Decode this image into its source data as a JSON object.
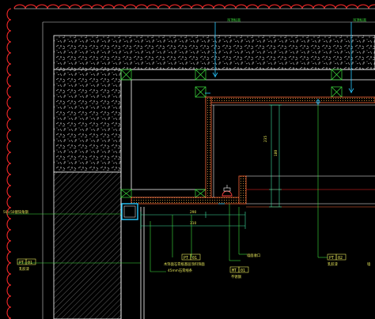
{
  "colors": {
    "background": "#000000",
    "cloud_line": "#ff2a2a",
    "wall": "#ffffff",
    "finish": "#ff6a3a",
    "leader": "#2ee02e",
    "dimension": "#3ee0a0",
    "axis": "#28c8ff",
    "label": "#e8e85a"
  },
  "labels": {
    "top_note_left": "吊顶标高",
    "top_note_right": "吊顶标高",
    "left_side_note": "50×50镀锌角钢",
    "dim_vertical_1": "235",
    "dim_vertical_2": "180",
    "dim_horizontal_1": "290",
    "dim_horizontal_2": "310"
  },
  "tags": [
    {
      "id": "tag-left",
      "code": "PT",
      "num": "01",
      "note": "乳胶漆"
    },
    {
      "id": "tag-mid",
      "code": "PT",
      "num": "01",
      "note": "木饰面",
      "note2": "石膏板基层涂料饰面",
      "note3": "45mm石膏线条"
    },
    {
      "id": "tag-mt",
      "code": "MT",
      "num": "01",
      "note": "不锈钢"
    },
    {
      "id": "tag-right",
      "code": "PT",
      "num": "02",
      "note": "乳胶漆"
    }
  ],
  "icons": {
    "revision_cloud": "revision-cloud-icon",
    "light_fixture": "downlight-icon",
    "column_box": "steel-column-icon"
  }
}
